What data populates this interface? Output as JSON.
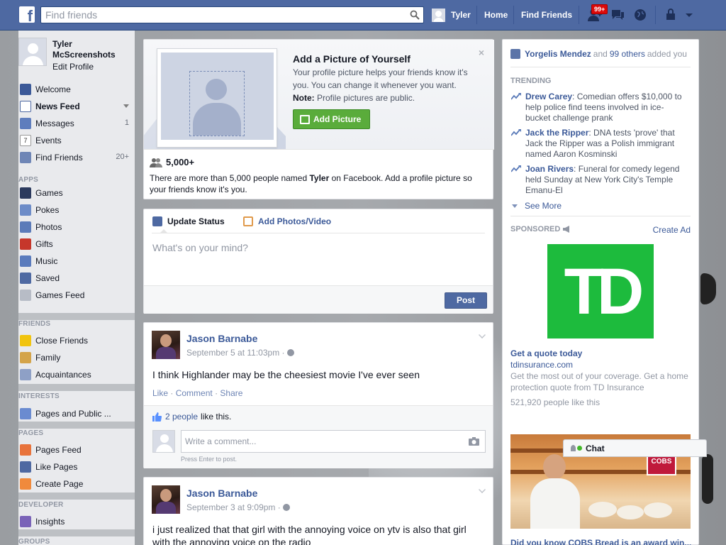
{
  "header": {
    "logo": "f",
    "search_placeholder": "Find friends",
    "user_name": "Tyler",
    "nav": [
      "Home",
      "Find Friends"
    ],
    "friend_request_badge": "99+",
    "colors": {
      "bar": "#4e69a2",
      "badge": "#dc0a0a"
    }
  },
  "sidebar": {
    "profile_name": "Tyler McScreenshots",
    "edit_profile": "Edit Profile",
    "main_items": [
      {
        "label": "Welcome",
        "icon": "facebook-icon",
        "count": ""
      },
      {
        "label": "News Feed",
        "icon": "news-feed-icon",
        "count": ""
      },
      {
        "label": "Messages",
        "icon": "messages-icon",
        "count": "1"
      },
      {
        "label": "Events",
        "icon": "calendar-icon",
        "count": ""
      },
      {
        "label": "Find Friends",
        "icon": "find-friends-icon",
        "count": "20+"
      }
    ],
    "apps_header": "APPS",
    "apps": [
      "Games",
      "Pokes",
      "Photos",
      "Gifts",
      "Music",
      "Saved",
      "Games Feed"
    ],
    "friends_header": "FRIENDS",
    "friends": [
      "Close Friends",
      "Family",
      "Acquaintances"
    ],
    "interests_header": "INTERESTS",
    "interests": [
      "Pages and Public ..."
    ],
    "pages_header": "PAGES",
    "pages": [
      "Pages Feed",
      "Like Pages",
      "Create Page"
    ],
    "developer_header": "DEVELOPER",
    "developer": [
      "Insights"
    ],
    "groups_header": "GROUPS"
  },
  "profile_prompt": {
    "title": "Add a Picture of Yourself",
    "text": "Your profile picture helps your friends know it's you. You can change it whenever you want.",
    "note_label": "Note:",
    "note_text": " Profile pictures are public.",
    "button": "Add Picture",
    "close": "×",
    "count": "5,000+",
    "desc_pre": "There are more than 5,000 people named ",
    "desc_name": "Tyler",
    "desc_post": " on Facebook. Add a profile picture so your friends know it's you."
  },
  "composer": {
    "tab_status": "Update Status",
    "tab_photos": "Add Photos/Video",
    "placeholder": "What's on your mind?",
    "post_button": "Post"
  },
  "posts": [
    {
      "author": "Jason Barnabe",
      "time": "September 5 at 11:03pm · ",
      "text": "I think Highlander may be the cheesiest movie I've ever seen",
      "actions": [
        "Like",
        "Comment",
        "Share"
      ],
      "likes_link": "2 people",
      "likes_text": "like this.",
      "comment_placeholder": "Write a comment...",
      "comment_hint": "Press Enter to post."
    },
    {
      "author": "Jason Barnabe",
      "time": "September 3 at 9:09pm · ",
      "text": "i just realized that that girl with the annoying voice on ytv is also that girl with the annoying voice on the radio"
    }
  ],
  "right": {
    "added_name": "Yorgelis Mendez",
    "added_and": "and",
    "added_others": "99 others",
    "added_suffix": "added you",
    "trending_header": "TRENDING",
    "trending": [
      {
        "topic": "Drew Carey",
        "desc": ": Comedian offers $10,000 to help police find teens involved in ice-bucket challenge prank"
      },
      {
        "topic": "Jack the Ripper",
        "desc": ": DNA tests 'prove' that Jack the Ripper was a Polish immigrant named Aaron Kosminski"
      },
      {
        "topic": "Joan Rivers",
        "desc": ": Funeral for comedy legend held Sunday at New York City's Temple Emanu-El"
      }
    ],
    "see_more": "See More",
    "sponsored": "SPONSORED",
    "create_ad": "Create Ad",
    "ad_logo": "TD",
    "ad_title": "Get a quote today",
    "ad_url": "tdinsurance.com",
    "ad_desc": "Get the most out of your coverage. Get a home protection quote from TD Insurance",
    "ad_likes": "521,920 people like this",
    "ad_brand_color": "#1dbb3d",
    "cobs_sign": "COBS",
    "cobs_caption": "Did you know COBS Bread is an award win..."
  },
  "chat": {
    "label": "Chat"
  }
}
